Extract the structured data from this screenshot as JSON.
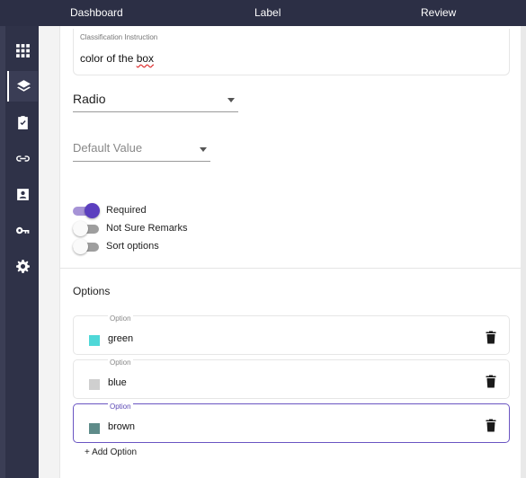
{
  "topnav": {
    "dashboard": "Dashboard",
    "label": "Label",
    "review": "Review"
  },
  "sidebar": {
    "items": [
      {
        "icon": "grid-icon"
      },
      {
        "icon": "layers-icon",
        "active": true
      },
      {
        "icon": "clipboard-check-icon"
      },
      {
        "icon": "link-icon"
      },
      {
        "icon": "contact-card-icon"
      },
      {
        "icon": "key-icon"
      },
      {
        "icon": "gear-icon"
      }
    ]
  },
  "form": {
    "instruction_label": "Classification Instruction",
    "instruction_value_prefix": "color of the ",
    "instruction_value_misspelled": "box",
    "type_select": "Radio",
    "default_value_placeholder": "Default Value",
    "toggles": [
      {
        "label": "Required",
        "on": true
      },
      {
        "label": "Not Sure Remarks",
        "on": false
      },
      {
        "label": "Sort options",
        "on": false
      }
    ],
    "options_title": "Options",
    "option_field_label": "Option",
    "options": [
      {
        "value": "green",
        "color": "#4fd8d8"
      },
      {
        "value": "blue",
        "color": "#cfcfcf"
      },
      {
        "value": "brown",
        "color": "#5e8b89",
        "focused": true
      }
    ],
    "add_option": "+ Add Option"
  },
  "colors": {
    "topbar": "#2c2f45",
    "sidebar": "#2f3248",
    "accent": "#5b3fbf",
    "toggle_track_on": "#a693d6"
  }
}
